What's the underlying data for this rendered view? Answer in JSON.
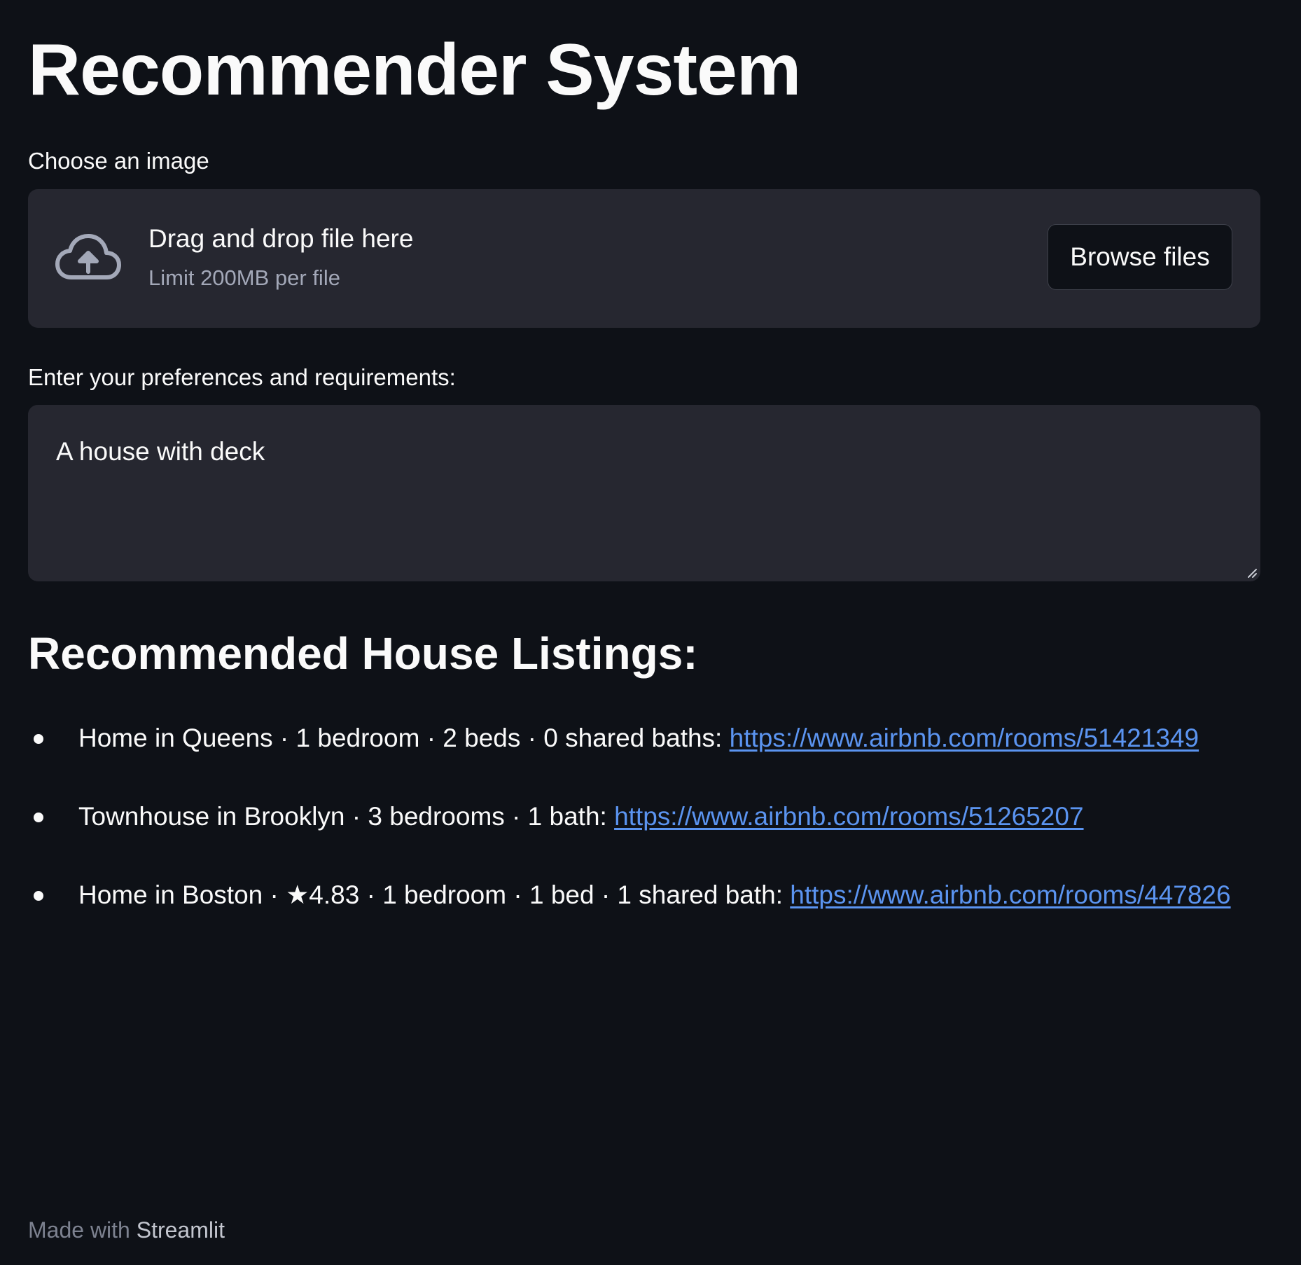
{
  "page": {
    "title": "Recommender System"
  },
  "uploader": {
    "label": "Choose an image",
    "icon": "cloud-upload-icon",
    "drop_text": "Drag and drop file here",
    "limit_text": "Limit 200MB per file",
    "browse_label": "Browse files"
  },
  "preferences": {
    "label": "Enter your preferences and requirements:",
    "value": "A house with deck"
  },
  "results": {
    "heading": "Recommended House Listings:",
    "items": [
      {
        "description": "Home in Queens · 1 bedroom · 2 beds · 0 shared baths: ",
        "url": "https://www.airbnb.com/rooms/51421349"
      },
      {
        "description": "Townhouse in Brooklyn · 3 bedrooms · 1 bath: ",
        "url": "https://www.airbnb.com/rooms/51265207"
      },
      {
        "description": "Home in Boston · ★4.83 · 1 bedroom · 1 bed · 1 shared bath: ",
        "url": "https://www.airbnb.com/rooms/447826"
      }
    ]
  },
  "footer": {
    "prefix": "Made with ",
    "brand": "Streamlit"
  },
  "colors": {
    "background": "#0e1117",
    "widget_background": "#262730",
    "text": "#fafafa",
    "muted_text": "#a3a8b8",
    "link": "#5b94f0"
  }
}
